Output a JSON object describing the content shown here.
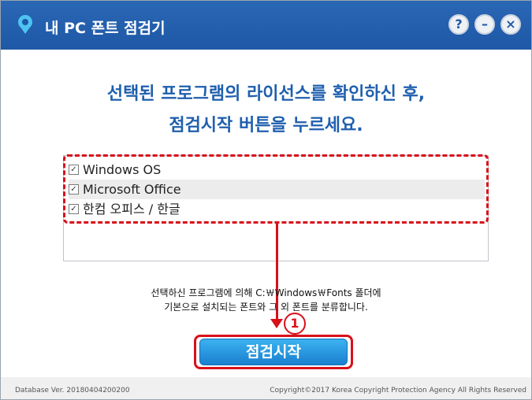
{
  "window": {
    "title": "내 PC 폰트 점검기",
    "buttons": {
      "help": "?",
      "minimize": "–",
      "close": "×"
    }
  },
  "heading": {
    "line1": "선택된 프로그램의 라이선스를 확인하신 후,",
    "line2": "점검시작 버튼을 누르세요."
  },
  "programs": [
    {
      "label": "Windows OS",
      "checked": true
    },
    {
      "label": "Microsoft Office",
      "checked": true
    },
    {
      "label": "한컴 오피스 / 한글",
      "checked": true
    }
  ],
  "checkbox_mark": "✓",
  "note": {
    "line1": "선택하신 프로그램에 의해 C:￦Windows￦Fonts 폴더에",
    "line2": "기본으로 설치되는 폰트와 그 외 폰트를 분류합니다."
  },
  "annotation": {
    "step": "1"
  },
  "start_button": {
    "label": "점검시작"
  },
  "footer": {
    "version": "Database Ver. 20180404200200",
    "copyright": "Copyright©2017 Korea Copyright Protection Agency All Rights Reserved"
  },
  "colors": {
    "titlebar": "#1e58a6",
    "heading": "#1f5fae",
    "highlight": "#d8101a",
    "button": "#1a7fd0"
  }
}
